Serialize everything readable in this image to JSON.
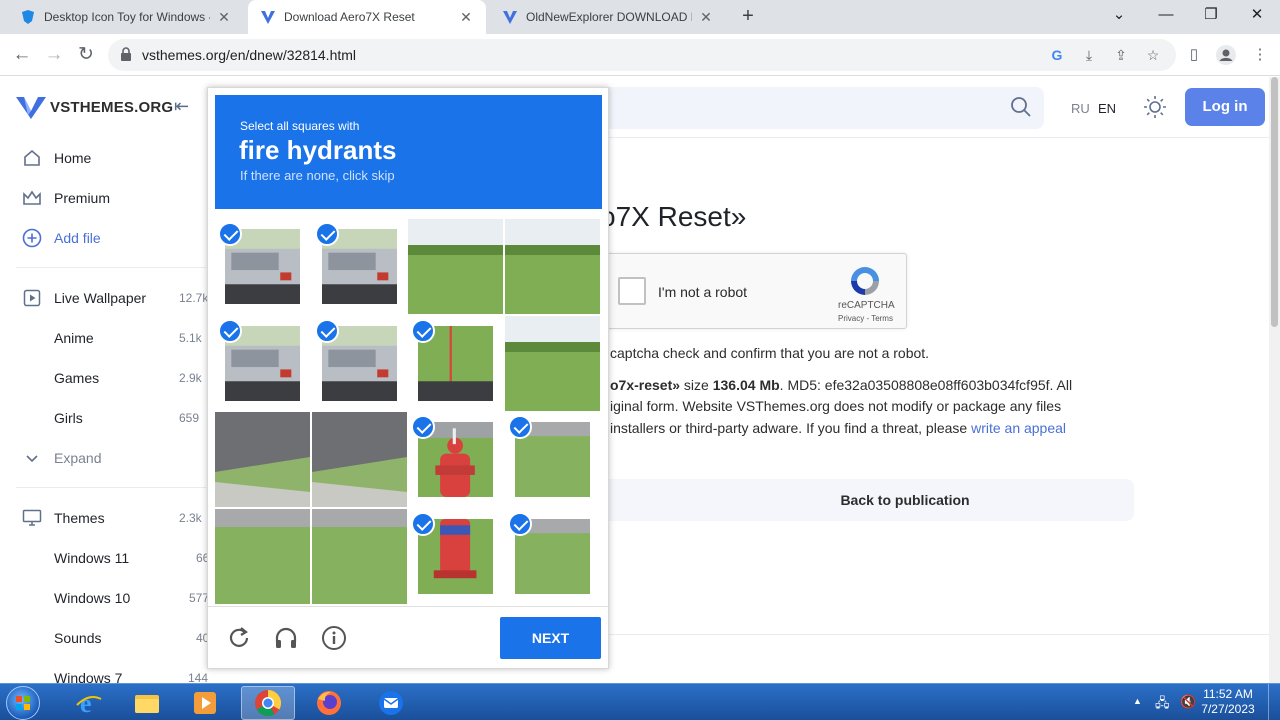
{
  "browser": {
    "tabs": [
      {
        "title": "Desktop Icon Toy for Windows -",
        "active": false
      },
      {
        "title": "Download Aero7X Reset",
        "active": true
      },
      {
        "title": "OldNewExplorer DOWNLOAD FR",
        "active": false
      }
    ],
    "url": "vsthemes.org/en/dnew/32814.html"
  },
  "site": {
    "brand": "VSTHEMES.ORG",
    "lang_ru": "RU",
    "lang_en": "EN",
    "login": "Log in"
  },
  "sidebar": {
    "items": [
      {
        "label": "Home",
        "count": "",
        "icon": "home-icon"
      },
      {
        "label": "Premium",
        "count": "",
        "icon": "crown-icon"
      },
      {
        "label": "Add file",
        "count": "",
        "icon": "plus-circle-icon"
      },
      {
        "label": "Live Wallpaper",
        "count": "12.7k",
        "icon": "play-icon"
      },
      {
        "label": "Anime",
        "count": "5.1k"
      },
      {
        "label": "Games",
        "count": "2.9k"
      },
      {
        "label": "Girls",
        "count": "659"
      },
      {
        "label": "Expand",
        "count": "",
        "icon": "chevron-down-icon"
      },
      {
        "label": "Themes",
        "count": "2.3k",
        "icon": "monitor-icon"
      },
      {
        "label": "Windows 11",
        "count": "66"
      },
      {
        "label": "Windows 10",
        "count": "577"
      },
      {
        "label": "Sounds",
        "count": "40"
      },
      {
        "label": "Windows 7",
        "count": "144"
      }
    ]
  },
  "content": {
    "title_fragment": "o7X Reset»",
    "recaptcha": {
      "label": "I'm not a robot",
      "brand": "reCAPTCHA",
      "links": "Privacy - Terms"
    },
    "line1": "captcha check and confirm that you are not a robot.",
    "line2_pre": "o7x-reset»",
    "line2_mid": " size ",
    "line2_size": "136.04 Mb",
    "line2_post": ". MD5: efe32a03508808e08ff603b034fcf95f. All",
    "line3": "iginal form. Website VSThemes.org does not modify or package any files",
    "line4_pre": " installers or third-party adware. If you find a threat, please ",
    "line4_link": "write an appeal",
    "back_button": "Back to publication"
  },
  "captcha": {
    "prompt": "Select all squares with",
    "target": "fire hydrants",
    "hint": "If there are none, click skip",
    "next_button": "NEXT",
    "selected": [
      [
        true,
        true,
        false,
        false
      ],
      [
        true,
        true,
        true,
        false
      ],
      [
        false,
        false,
        true,
        true
      ],
      [
        false,
        false,
        true,
        true
      ]
    ]
  },
  "taskbar": {
    "time": "11:52 AM",
    "date": "7/27/2023"
  },
  "colors": {
    "captcha_blue": "#1a73e8",
    "accent": "#5b82e8"
  }
}
